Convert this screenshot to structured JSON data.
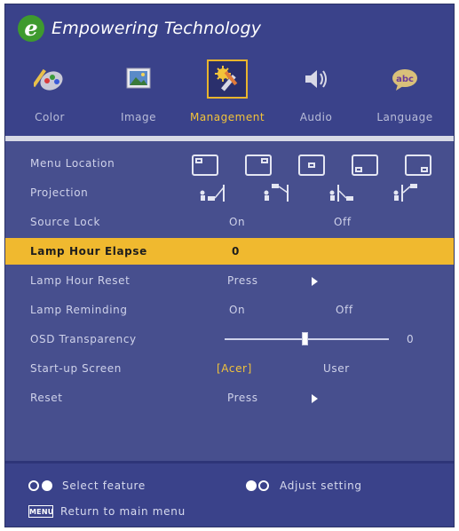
{
  "brand": {
    "logo_letter": "e",
    "title": "Empowering Technology"
  },
  "tabs": [
    {
      "label": "Color",
      "icon": "color-palette-icon"
    },
    {
      "label": "Image",
      "icon": "image-icon"
    },
    {
      "label": "Management",
      "icon": "wrench-screwdriver-icon",
      "active": true
    },
    {
      "label": "Audio",
      "icon": "speaker-icon"
    },
    {
      "label": "Language",
      "icon": "language-abc-icon"
    }
  ],
  "menu": {
    "menu_location": {
      "label": "Menu Location"
    },
    "projection": {
      "label": "Projection"
    },
    "source_lock": {
      "label": "Source Lock",
      "on": "On",
      "off": "Off"
    },
    "lamp_hour_elapse": {
      "label": "Lamp Hour Elapse",
      "value": "0"
    },
    "lamp_hour_reset": {
      "label": "Lamp Hour Reset",
      "value": "Press"
    },
    "lamp_reminding": {
      "label": "Lamp Reminding",
      "on": "On",
      "off": "Off"
    },
    "osd_transparency": {
      "label": "OSD Transparency",
      "value": "0",
      "level": 0.5
    },
    "startup_screen": {
      "label": "Start-up Screen",
      "acer": "[Acer]",
      "user": "User"
    },
    "reset": {
      "label": "Reset",
      "value": "Press"
    }
  },
  "footer": {
    "select_feature": "Select feature",
    "adjust_setting": "Adjust setting",
    "menu_key": "MENU",
    "return_main": "Return to main menu"
  },
  "colors": {
    "selection": "#f0b92f",
    "accent": "#e8b42d",
    "background": "#474f8e"
  }
}
